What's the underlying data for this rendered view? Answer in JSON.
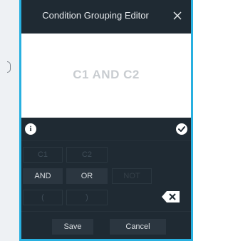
{
  "dialog": {
    "title": "Condition Grouping Editor",
    "accent_color": "#28b0e0",
    "background_color": "#1f2a33"
  },
  "close_icon": "close-icon",
  "preview": {
    "expression": "C1 AND C2"
  },
  "info_row": {
    "info_icon": "info-icon",
    "confirm_icon": "check-circle-icon"
  },
  "conditions": [
    {
      "label": "C1"
    },
    {
      "label": "C2"
    }
  ],
  "operators": [
    {
      "label": "AND",
      "state": "enabled"
    },
    {
      "label": "OR",
      "state": "enabled"
    },
    {
      "label": "NOT",
      "state": "disabled"
    }
  ],
  "parentheses": [
    {
      "label": "("
    },
    {
      "label": ")"
    }
  ],
  "backspace_icon": "backspace-icon",
  "footer": {
    "save_label": "Save",
    "cancel_label": "Cancel"
  }
}
